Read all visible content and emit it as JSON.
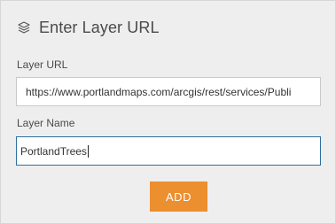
{
  "header": {
    "icon": "layers-icon",
    "title": "Enter Layer URL"
  },
  "form": {
    "url_label": "Layer URL",
    "url_value": "https://www.portlandmaps.com/arcgis/rest/services/Publi",
    "name_label": "Layer Name",
    "name_value": "PortlandTrees"
  },
  "actions": {
    "add_label": "ADD"
  },
  "colors": {
    "accent": "#ec8f2f",
    "panel_bg": "#eeeeee",
    "focus_border": "#2f6f9e"
  }
}
